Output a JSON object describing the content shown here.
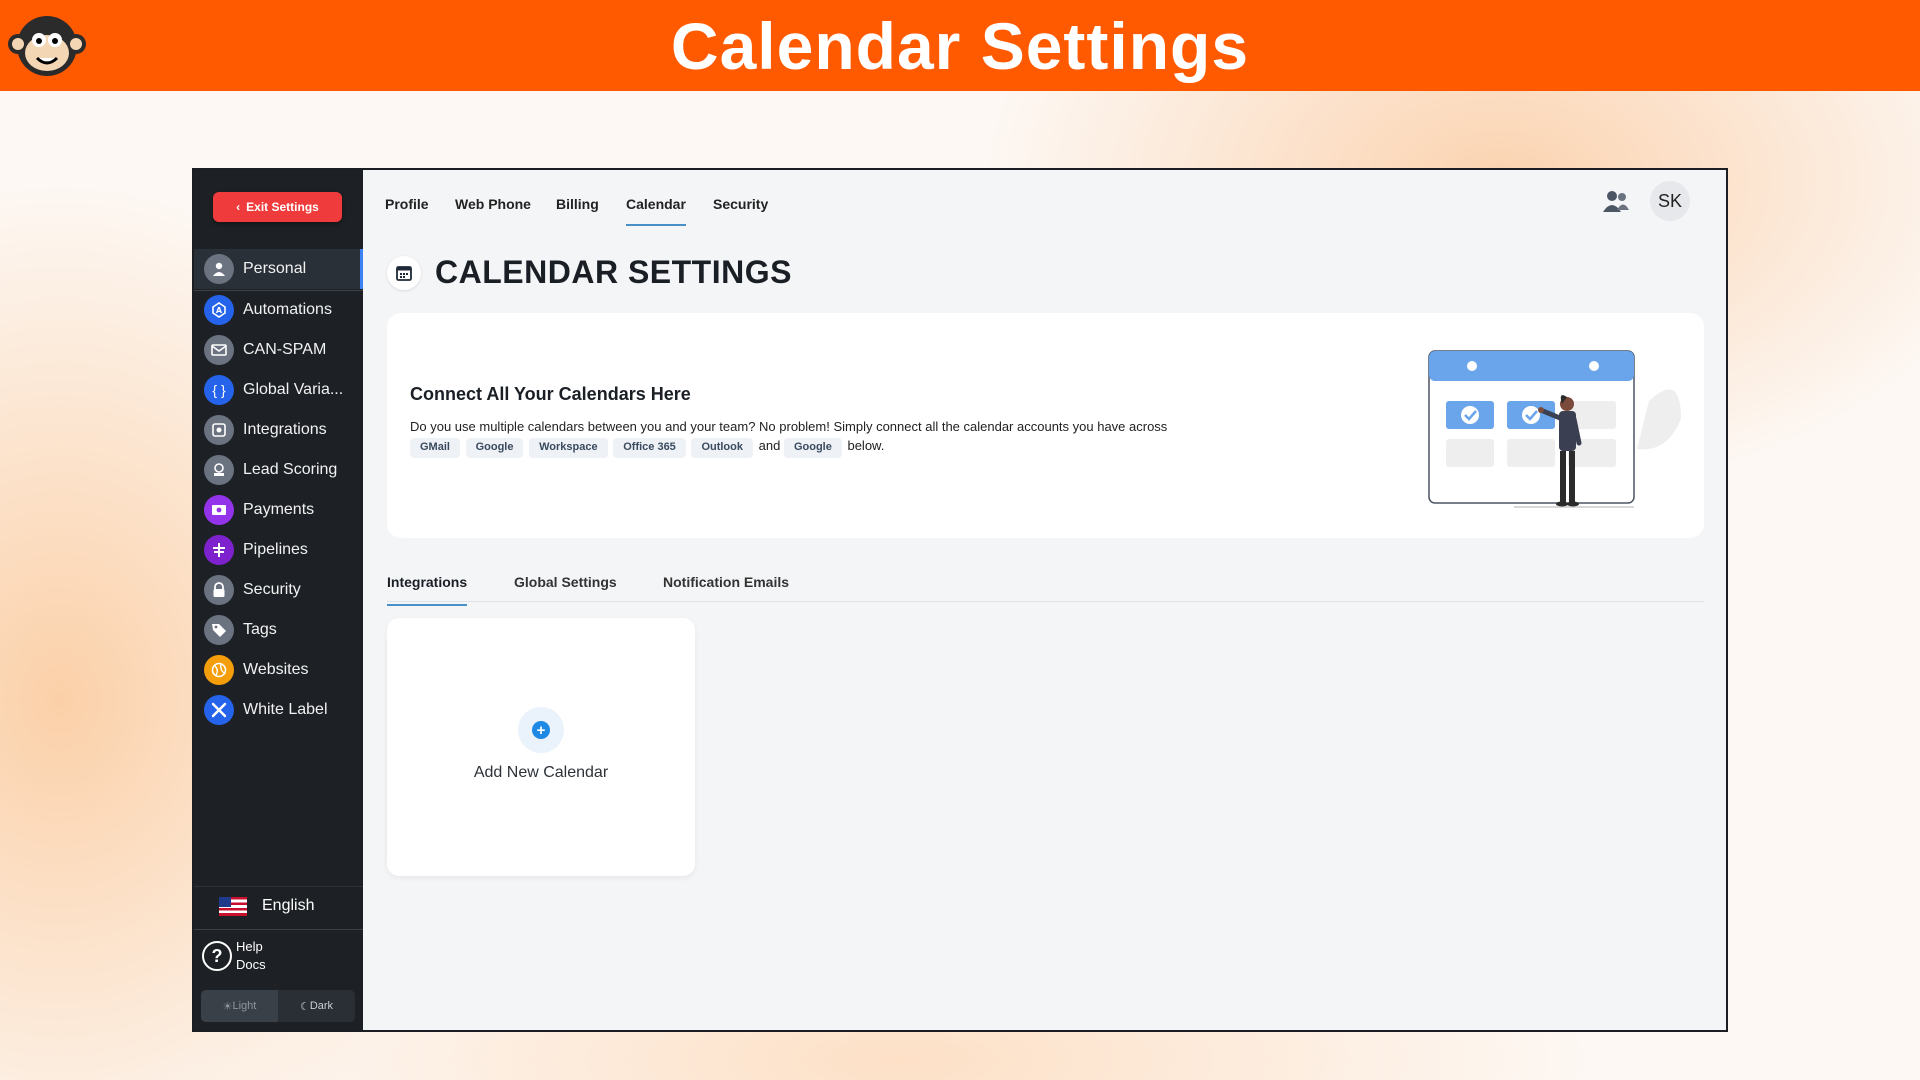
{
  "banner": {
    "title": "Calendar Settings"
  },
  "sidebar": {
    "exit_label": "Exit Settings",
    "items": [
      {
        "label": "Personal",
        "icon": "person-icon",
        "color": "#6b7280"
      },
      {
        "label": "Automations",
        "icon": "automation-icon",
        "color": "#2563eb"
      },
      {
        "label": "CAN-SPAM",
        "icon": "mail-icon",
        "color": "#6b7280"
      },
      {
        "label": "Global Varia...",
        "icon": "braces-icon",
        "color": "#2563eb"
      },
      {
        "label": "Integrations",
        "icon": "integrations-icon",
        "color": "#6b7280"
      },
      {
        "label": "Lead Scoring",
        "icon": "lead-scoring-icon",
        "color": "#6b7280"
      },
      {
        "label": "Payments",
        "icon": "payments-icon",
        "color": "#9333ea"
      },
      {
        "label": "Pipelines",
        "icon": "pipelines-icon",
        "color": "#7e22ce"
      },
      {
        "label": "Security",
        "icon": "lock-icon",
        "color": "#6b7280"
      },
      {
        "label": "Tags",
        "icon": "tag-icon",
        "color": "#6b7280"
      },
      {
        "label": "Websites",
        "icon": "globe-icon",
        "color": "#f59e0b"
      },
      {
        "label": "White Label",
        "icon": "tools-icon",
        "color": "#2563eb"
      }
    ],
    "language": "English",
    "help": {
      "line1": "Help",
      "line2": "Docs"
    },
    "theme": {
      "light": "Light",
      "dark": "Dark"
    }
  },
  "topnav": {
    "tabs": [
      "Profile",
      "Web Phone",
      "Billing",
      "Calendar",
      "Security"
    ],
    "active": "Calendar",
    "avatar_initials": "SK"
  },
  "page": {
    "title": "CALENDAR SETTINGS",
    "hero": {
      "title": "Connect All Your Calendars Here",
      "description": "Do you use multiple calendars between you and your team? No problem! Simply connect all the calendar accounts you have across",
      "chips": [
        "GMail",
        "Google",
        "Workspace",
        "Office 365",
        "Outlook"
      ],
      "and_text": "and",
      "last_chip": "Google",
      "tail": "below."
    },
    "subtabs": [
      "Integrations",
      "Global Settings",
      "Notification Emails"
    ],
    "active_subtab": "Integrations",
    "add_calendar_label": "Add New Calendar"
  },
  "colors": {
    "brand": "#ff5a00",
    "accent": "#4a90c8",
    "exit": "#ef3b3b",
    "sidebar": "#1d2125"
  }
}
